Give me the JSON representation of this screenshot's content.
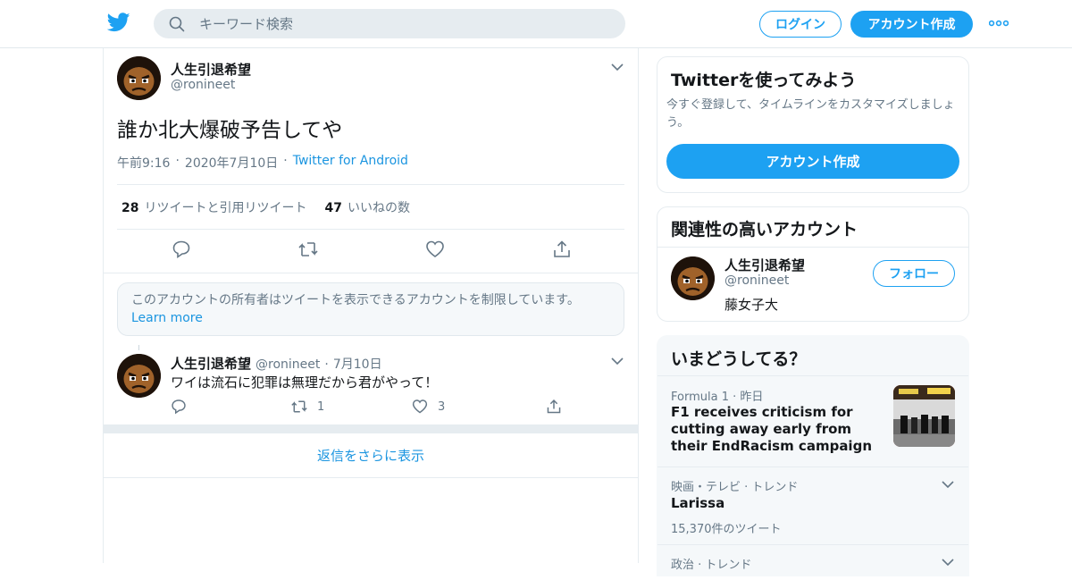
{
  "header": {
    "logo_icon": "twitter-bird-icon",
    "search_placeholder": "キーワード検索",
    "login_label": "ログイン",
    "signup_label": "アカウント作成",
    "more_icon": "more-dots-icon"
  },
  "tweet": {
    "author_name": "人生引退希望",
    "author_handle": "@ronineet",
    "text": "誰か北大爆破予告してや",
    "time": "午前9:16",
    "date": "2020年7月10日",
    "source": "Twitter for Android",
    "retweet_count": "28",
    "retweet_label": "リツイートと引用リツイート",
    "like_count": "47",
    "like_label": "いいねの数"
  },
  "notice": {
    "text": "このアカウントの所有者はツイートを表示できるアカウントを制限しています。",
    "link": "Learn more"
  },
  "reply": {
    "author_name": "人生引退希望",
    "author_handle": "@ronineet",
    "date": "7月10日",
    "text": "ワイは流石に犯罪は無理だから君がやって！",
    "retweet_count": "1",
    "like_count": "3"
  },
  "more_replies_label": "返信をさらに表示",
  "sidebar": {
    "signup_card": {
      "title": "Twitterを使ってみよう",
      "description": "今すぐ登録して、タイムラインをカスタマイズしましょう。",
      "button": "アカウント作成"
    },
    "related": {
      "title": "関連性の高いアカウント",
      "name": "人生引退希望",
      "handle": "@ronineet",
      "bio": "藤女子大",
      "follow_label": "フォロー"
    },
    "trends": {
      "title": "いまどうしてる？",
      "items": [
        {
          "context": "Formula 1",
          "time": "昨日",
          "name": "F1 receives criticism for cutting away early from their EndRacism campaign"
        },
        {
          "context": "映画・テレビ · トレンド",
          "name": "Larissa",
          "count": "15,370件のツイート"
        },
        {
          "context": "政治 · トレンド"
        }
      ]
    }
  },
  "colors": {
    "brand": "#1da1f2",
    "link": "#1b95e0",
    "text_secondary": "#657786",
    "border": "#e6ecf0"
  }
}
